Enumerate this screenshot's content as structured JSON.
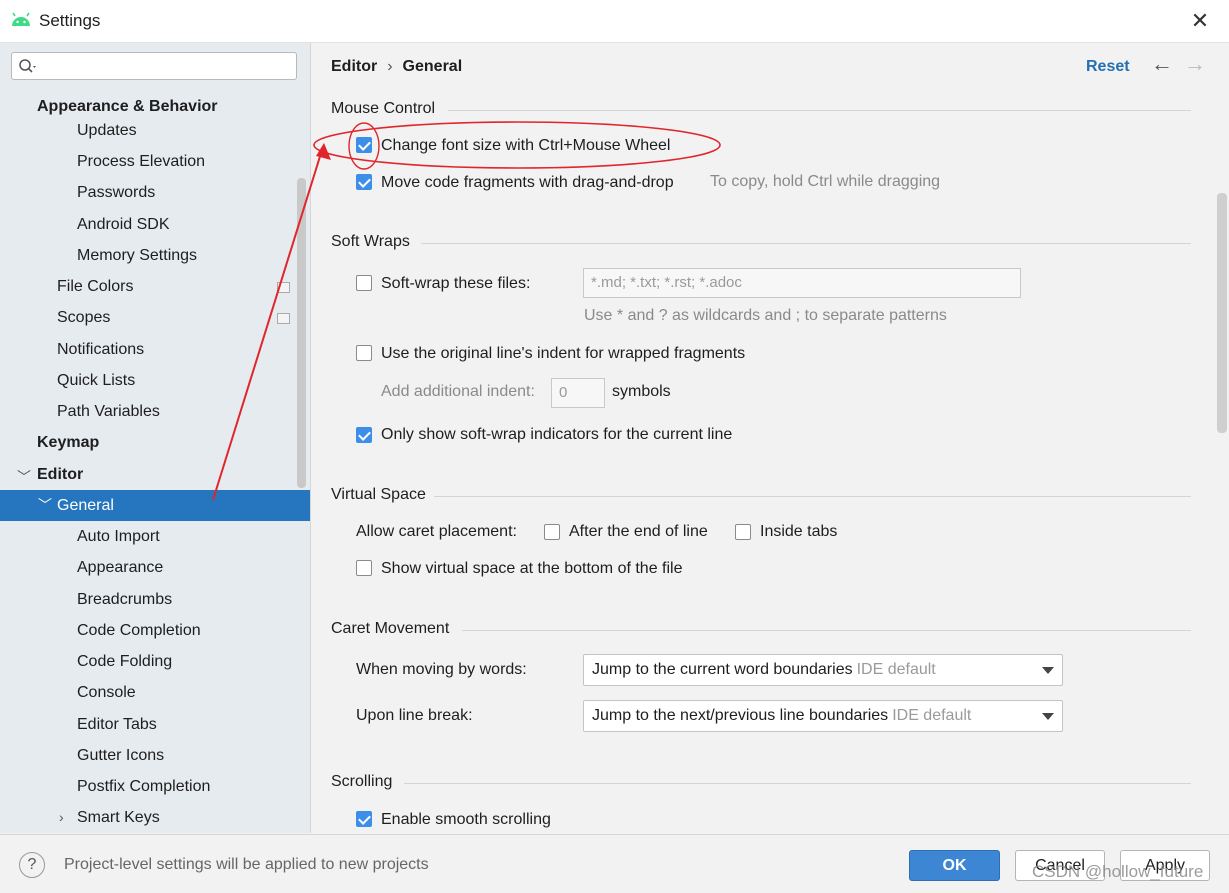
{
  "window": {
    "title": "Settings"
  },
  "search": {
    "placeholder": ""
  },
  "sidebar": {
    "items": [
      {
        "label": "Appearance & Behavior"
      },
      {
        "label": "Updates"
      },
      {
        "label": "Process Elevation"
      },
      {
        "label": "Passwords"
      },
      {
        "label": "Android SDK"
      },
      {
        "label": "Memory Settings"
      },
      {
        "label": "File Colors"
      },
      {
        "label": "Scopes"
      },
      {
        "label": "Notifications"
      },
      {
        "label": "Quick Lists"
      },
      {
        "label": "Path Variables"
      },
      {
        "label": "Keymap"
      },
      {
        "label": "Editor"
      },
      {
        "label": "General"
      },
      {
        "label": "Auto Import"
      },
      {
        "label": "Appearance"
      },
      {
        "label": "Breadcrumbs"
      },
      {
        "label": "Code Completion"
      },
      {
        "label": "Code Folding"
      },
      {
        "label": "Console"
      },
      {
        "label": "Editor Tabs"
      },
      {
        "label": "Gutter Icons"
      },
      {
        "label": "Postfix Completion"
      },
      {
        "label": "Smart Keys"
      }
    ]
  },
  "header": {
    "crumb_parent": "Editor",
    "crumb_separator": "›",
    "crumb_current": "General",
    "reset": "Reset"
  },
  "mouse_control": {
    "title": "Mouse Control",
    "font_size_label": "Change font size with Ctrl+Mouse Wheel",
    "font_size_checked": true,
    "drag_drop_label": "Move code fragments with drag-and-drop",
    "drag_drop_checked": true,
    "drag_drop_hint": "To copy, hold Ctrl while dragging"
  },
  "soft_wraps": {
    "title": "Soft Wraps",
    "softwrap_label": "Soft-wrap these files:",
    "softwrap_checked": false,
    "patterns_value": "*.md; *.txt; *.rst; *.adoc",
    "patterns_hint": "Use * and ? as wildcards and ; to separate patterns",
    "indent_label": "Use the original line's indent for wrapped fragments",
    "indent_checked": false,
    "additional_indent_label": "Add additional indent:",
    "additional_indent_value": "0",
    "symbols_label": "symbols",
    "indicators_label": "Only show soft-wrap indicators for the current line",
    "indicators_checked": true
  },
  "virtual_space": {
    "title": "Virtual Space",
    "caret_label": "Allow caret placement:",
    "after_end_label": "After the end of line",
    "after_end_checked": false,
    "inside_tabs_label": "Inside tabs",
    "inside_tabs_checked": false,
    "bottom_label": "Show virtual space at the bottom of the file",
    "bottom_checked": false
  },
  "caret_movement": {
    "title": "Caret Movement",
    "words_label": "When moving by words:",
    "words_value": "Jump to the current word boundaries",
    "words_tag": "IDE default",
    "linebreak_label": "Upon line break:",
    "linebreak_value": "Jump to the next/previous line boundaries",
    "linebreak_tag": "IDE default"
  },
  "scrolling": {
    "title": "Scrolling",
    "smooth_label": "Enable smooth scrolling",
    "smooth_checked": true
  },
  "footer": {
    "note": "Project-level settings will be applied to new projects",
    "help": "?",
    "ok": "OK",
    "cancel": "Cancel",
    "apply": "Apply"
  },
  "watermark": "CSDN @hollow_future",
  "colors": {
    "accent": "#2675bf",
    "annotation": "#e0262b",
    "checkbox": "#3d8ee8"
  }
}
